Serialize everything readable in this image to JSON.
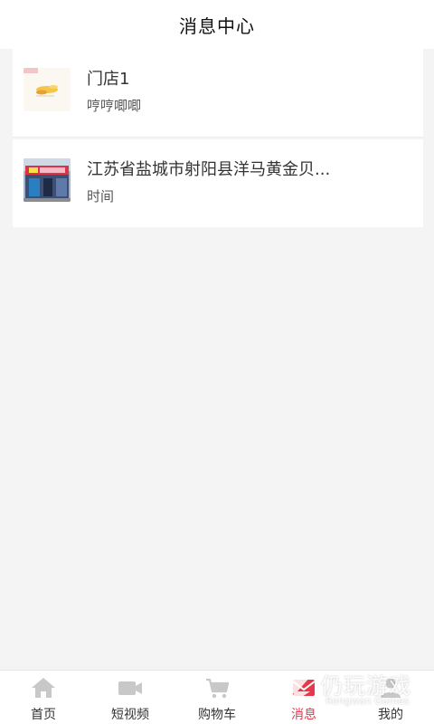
{
  "header": {
    "title": "消息中心"
  },
  "messages": [
    {
      "title": "门店1",
      "subtitle": "哼哼唧唧"
    },
    {
      "title": "江苏省盐城市射阳县洋马黄金贝...",
      "subtitle": "时间"
    }
  ],
  "tabbar": {
    "items": [
      {
        "label": "首页",
        "icon": "home-icon"
      },
      {
        "label": "短视频",
        "icon": "video-camera-icon"
      },
      {
        "label": "购物车",
        "icon": "cart-icon"
      },
      {
        "label": "消息",
        "icon": "message-icon",
        "active": true
      },
      {
        "label": "我的",
        "icon": "user-icon"
      }
    ],
    "active_color": "#e6384a",
    "inactive_icon_color": "#c8c8c8"
  },
  "watermark": {
    "text": "仍玩游戏",
    "sub": "Rengwan Games"
  }
}
